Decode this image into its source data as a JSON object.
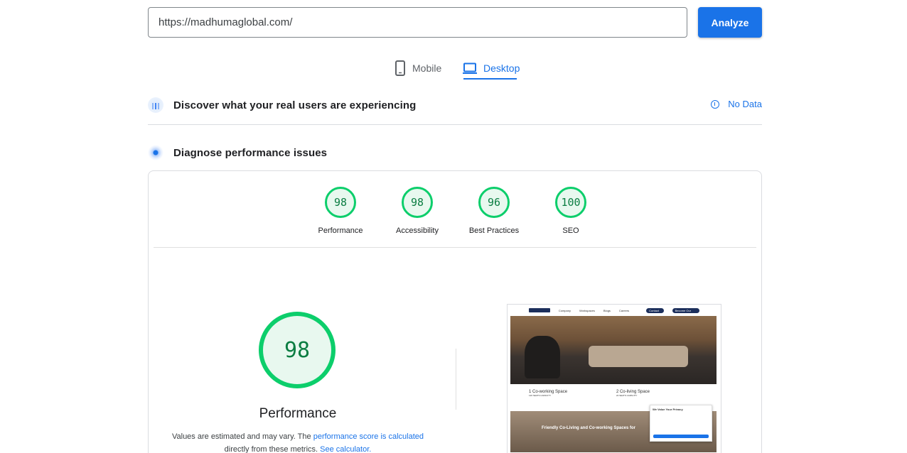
{
  "search": {
    "value": "https://madhumaglobal.com/",
    "analyze_label": "Analyze"
  },
  "tabs": [
    {
      "label": "Mobile",
      "icon": "phone-icon",
      "active": false
    },
    {
      "label": "Desktop",
      "icon": "laptop-icon",
      "active": true
    }
  ],
  "field_data": {
    "title": "Discover what your real users are experiencing",
    "status": "No Data"
  },
  "lab_data": {
    "title": "Diagnose performance issues"
  },
  "categories": [
    {
      "score": "98",
      "label": "Performance"
    },
    {
      "score": "98",
      "label": "Accessibility"
    },
    {
      "score": "96",
      "label": "Best Practices"
    },
    {
      "score": "100",
      "label": "SEO"
    }
  ],
  "summary": {
    "score": "98",
    "title": "Performance",
    "note_prefix": "Values are estimated and may vary. The",
    "note_link1": "performance score is calculated",
    "note_mid": "directly from these metrics.",
    "note_link2": "See calculator."
  },
  "thumbnail": {
    "nav_items": [
      "Company",
      "Workspaces",
      "Blogs",
      "Careers"
    ],
    "nav_cta_1": "Contact Us",
    "nav_cta_2": "Become Our Partner",
    "stat1_title": "1 Co-working Space",
    "stat1_sub": "120 SEATS CAPACITY",
    "stat2_title": "2 Co-living Space",
    "stat2_sub": "24 SEATS CAPACITY",
    "banner": "Friendly Co-Living and Co-working Spaces for",
    "cookie_title": "We Value Your Privacy"
  },
  "colors": {
    "accent": "#1a73e8",
    "pass": "#0cce6b",
    "pass_text": "#0b7d42"
  }
}
